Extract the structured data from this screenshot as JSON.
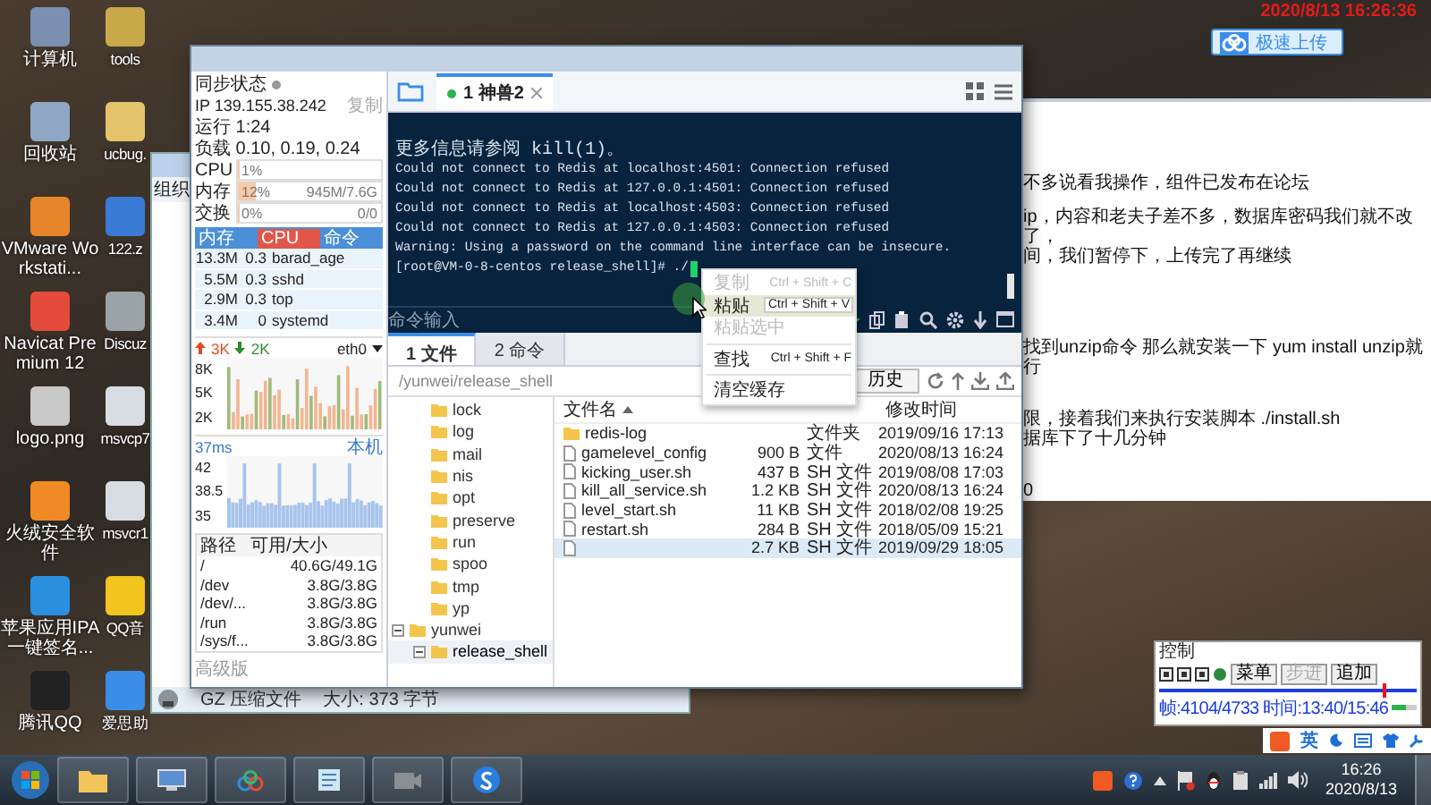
{
  "recorder_timestamp": "2020/8/13 16:26:36",
  "upload_button": {
    "label": "极速上传"
  },
  "desktop_icons": [
    {
      "label": "计算机"
    },
    {
      "label": "tools"
    },
    {
      "label": "回收站"
    },
    {
      "label": "ucbug."
    },
    {
      "label": "VMware Workstati..."
    },
    {
      "label": "122.z"
    },
    {
      "label": "Navicat Premium 12"
    },
    {
      "label": "Discuz"
    },
    {
      "label": "logo.png"
    },
    {
      "label": "msvcp7"
    },
    {
      "label": "火绒安全软件"
    },
    {
      "label": "msvcr1"
    },
    {
      "label": "苹果应用IPA一键签名..."
    },
    {
      "label": "QQ音"
    },
    {
      "label": "腾讯QQ"
    },
    {
      "label": "爱思助"
    }
  ],
  "explorer": {
    "toolbar_label": "组织",
    "file_type": "GZ 压缩文件",
    "file_size": "大小: 373 字节"
  },
  "finalshell": {
    "monitor": {
      "sync_label": "同步状态",
      "ip_label": "IP 139.155.38.242",
      "copy_label": "复制",
      "uptime": "运行 1:24",
      "load": "负载 0.10, 0.19, 0.24",
      "meters": [
        {
          "label": "CPU",
          "value": "1%",
          "level": 0.01
        },
        {
          "label": "内存",
          "value": "12%",
          "detail": "945M/7.6G",
          "level": 0.12
        },
        {
          "label": "交换",
          "value": "0%",
          "detail": "0/0",
          "level": 0
        }
      ],
      "process_columns": [
        {
          "label": "内存",
          "selected": false
        },
        {
          "label": "CPU",
          "selected": true
        },
        {
          "label": "命令",
          "selected": false
        }
      ],
      "processes": [
        {
          "memory": "13.3M",
          "cpu": "0.3",
          "command": "barad_age"
        },
        {
          "memory": "5.5M",
          "cpu": "0.3",
          "command": "sshd"
        },
        {
          "memory": "2.9M",
          "cpu": "0.3",
          "command": "top"
        },
        {
          "memory": "3.4M",
          "cpu": "0",
          "command": "systemd"
        }
      ],
      "network": {
        "upload": "3K",
        "download": "2K",
        "interface": "eth0",
        "ticks": [
          "8K",
          "5K",
          "2K"
        ]
      },
      "latency": {
        "reading": "37ms",
        "host": "本机",
        "ticks": [
          "42",
          "38.5",
          "35"
        ]
      },
      "disk_columns": [
        "路径",
        "可用/大小"
      ],
      "disks": [
        {
          "path": "/",
          "size": "40.6G/49.1G"
        },
        {
          "path": "/dev",
          "size": "3.8G/3.8G"
        },
        {
          "path": "/dev/...",
          "size": "3.8G/3.8G"
        },
        {
          "path": "/run",
          "size": "3.8G/3.8G"
        },
        {
          "path": "/sys/f...",
          "size": "3.8G/3.8G"
        }
      ],
      "edition_link": "高级版"
    },
    "session_tab": {
      "label": "1 神兽2",
      "connected": true
    },
    "terminal_lines": [
      {
        "text": "更多信息请参阅 kill(1)。",
        "kind": "cjk"
      },
      {
        "text": "Could not connect to Redis at localhost:4501: Connection refused",
        "kind": "plain"
      },
      {
        "text": "Could not connect to Redis at 127.0.0.1:4501: Connection refused",
        "kind": "plain"
      },
      {
        "text": "Could not connect to Redis at localhost:4503: Connection refused",
        "kind": "plain"
      },
      {
        "text": "Could not connect to Redis at 127.0.0.1:4503: Connection refused",
        "kind": "plain"
      },
      {
        "text": "Warning: Using a password on the command line interface can be insecure.",
        "kind": "plain"
      },
      {
        "text": "[root@VM-0-8-centos release_shell]# ./",
        "kind": "prompt"
      }
    ],
    "command_input": {
      "placeholder": "命令输入"
    },
    "panel_tabs": [
      {
        "label": "1 文件",
        "selected": true
      },
      {
        "label": "2 命令",
        "selected": false
      }
    ],
    "path": "/yunwei/release_shell",
    "history_button": "历史",
    "tree": [
      {
        "children": [
          {
            "label": "lock",
            "selected": false
          },
          {
            "label": "log",
            "selected": false
          },
          {
            "label": "mail",
            "selected": false
          },
          {
            "label": "nis",
            "selected": false
          },
          {
            "label": "opt",
            "selected": false
          },
          {
            "label": "preserve",
            "selected": false
          },
          {
            "label": "run",
            "selected": false
          },
          {
            "label": "spoo",
            "selected": false
          },
          {
            "label": "tmp",
            "selected": false
          },
          {
            "label": "yp",
            "selected": false
          }
        ]
      },
      {
        "label": "yunwei",
        "expanded": true,
        "selected": false,
        "children": [
          {
            "label": "release_shell",
            "expanded": true,
            "selected": true
          }
        ]
      }
    ],
    "file_columns": {
      "name": "文件名",
      "modified": "修改时间"
    },
    "files": [
      {
        "kind": "folder",
        "name": "redis-log",
        "type": "文件夹",
        "modified": "2019/09/16 17:13",
        "selected": false
      },
      {
        "kind": "file",
        "name": "gamelevel_config",
        "size": "900 B",
        "type": "文件",
        "modified": "2020/08/13 16:24",
        "selected": false
      },
      {
        "kind": "file",
        "name": "kicking_user.sh",
        "size": "437 B",
        "type": "SH 文件",
        "modified": "2019/08/08 17:03",
        "selected": false
      },
      {
        "kind": "file",
        "name": "kill_all_service.sh",
        "size": "1.2 KB",
        "type": "SH 文件",
        "modified": "2020/08/13 16:24",
        "selected": false
      },
      {
        "kind": "file",
        "name": "level_start.sh",
        "size": "11 KB",
        "type": "SH 文件",
        "modified": "2018/02/08 19:25",
        "selected": false
      },
      {
        "kind": "file",
        "name": "restart.sh",
        "size": "284 B",
        "type": "SH 文件",
        "modified": "2018/05/09 15:21",
        "selected": false
      },
      {
        "kind": "file",
        "size": "2.7 KB",
        "type": "SH 文件",
        "modified": "2019/09/29 18:05",
        "selected": true
      }
    ]
  },
  "context_menu": [
    {
      "kind": "item",
      "label": "复制",
      "shortcut": "Ctrl + Shift + C",
      "disabled": true,
      "selected": false
    },
    {
      "kind": "item",
      "label": "粘贴",
      "shortcut": "Ctrl + Shift + V",
      "disabled": false,
      "selected": true
    },
    {
      "kind": "item",
      "label": "粘贴选中",
      "disabled": true,
      "selected": false
    },
    {
      "kind": "separator"
    },
    {
      "kind": "item",
      "label": "查找",
      "shortcut": "Ctrl + Shift + F",
      "disabled": false,
      "selected": false
    },
    {
      "kind": "separator"
    },
    {
      "kind": "item",
      "label": "清空缓存",
      "disabled": false,
      "selected": false
    }
  ],
  "notepad_lines": [
    "不多说看我操作，组件已发布在论坛",
    "ip，内容和老夫子差不多，数据库密码我们就不改了，",
    "间，我们暂停下，上传完了再继续",
    "找到unzip命令 那么就安装一下 yum install unzip就行",
    "限，接着我们来执行安装脚本 ./install.sh",
    "据库下了十几分钟",
    "0"
  ],
  "player": {
    "title": "控制",
    "buttons": [
      {
        "label": "菜单",
        "disabled": false
      },
      {
        "label": "步进",
        "disabled": true
      },
      {
        "label": "追加",
        "disabled": false
      }
    ],
    "level": 0.867,
    "status": "帧:4104/4733 时间:13:40/15:46",
    "volume": {
      "level": 0.6
    }
  },
  "ime": {
    "mode": "英"
  },
  "clock": {
    "time": "16:26",
    "date": "2020/8/13"
  }
}
